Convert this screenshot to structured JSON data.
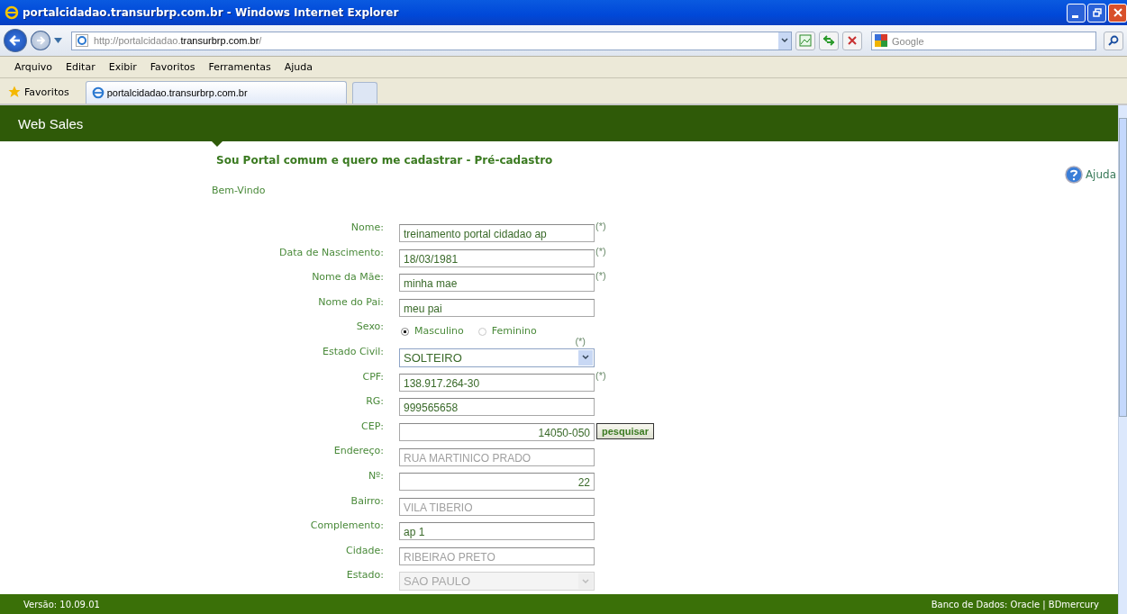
{
  "window": {
    "title": "portalcidadao.transurbrp.com.br - Windows Internet Explorer"
  },
  "address_bar": {
    "url_prefix": "http://portalcidadao.",
    "url_domain": "transurbrp.com.br",
    "url_suffix": "/"
  },
  "search": {
    "placeholder": "Google"
  },
  "menu": [
    "Arquivo",
    "Editar",
    "Exibir",
    "Favoritos",
    "Ferramentas",
    "Ajuda"
  ],
  "favorites_bar": {
    "label": "Favoritos",
    "tabs": [
      {
        "title": "portalcidadao.transurbrp.com.br",
        "selected": true
      }
    ]
  },
  "page": {
    "app_title": "Web Sales",
    "heading": "Sou Portal comum e quero me cadastrar - Pré-cadastro",
    "welcome": "Bem-Vindo",
    "help": "Ajuda",
    "fields": [
      {
        "kind": "text",
        "label": "Nome:",
        "value": "treinamento portal cidadao ap",
        "required": "(*)",
        "disabled": false
      },
      {
        "kind": "text",
        "label": "Data de Nascimento:",
        "value": "18/03/1981",
        "required": "(*)",
        "disabled": false
      },
      {
        "kind": "text",
        "label": "Nome da Mãe:",
        "value": "minha mae",
        "required": "(*)",
        "disabled": false
      },
      {
        "kind": "text",
        "label": "Nome do Pai:",
        "value": "meu pai",
        "disabled": false
      },
      {
        "kind": "radio",
        "label": "Sexo:",
        "options": [
          {
            "label": "Masculino",
            "selected": true
          },
          {
            "label": "Feminino",
            "selected": false
          }
        ]
      },
      {
        "kind": "select",
        "label": "Estado Civil:",
        "value": "SOLTEIRO",
        "required": "(*)",
        "disabled": false
      },
      {
        "kind": "text",
        "label": "CPF:",
        "value": "138.917.264-30",
        "required": "(*)",
        "disabled": false
      },
      {
        "kind": "text",
        "label": "RG:",
        "value": "999565658",
        "disabled": false
      },
      {
        "kind": "number",
        "label": "CEP:",
        "value": "14050-050",
        "disabled": false,
        "button": "pesquisar"
      },
      {
        "kind": "text",
        "label": "Endereço:",
        "value": "RUA MARTINICO PRADO",
        "disabled": true
      },
      {
        "kind": "number",
        "label": "Nº:",
        "value": "22",
        "disabled": false
      },
      {
        "kind": "text",
        "label": "Bairro:",
        "value": "VILA TIBERIO",
        "disabled": true
      },
      {
        "kind": "text",
        "label": "Complemento:",
        "value": "ap 1",
        "disabled": false
      },
      {
        "kind": "text",
        "label": "Cidade:",
        "value": "RIBEIRAO PRETO",
        "disabled": true
      },
      {
        "kind": "select",
        "label": "Estado:",
        "value": "SAO PAULO",
        "disabled": true
      }
    ],
    "footer": {
      "version": "Versão: 10.09.01",
      "database": "Banco de Dados: Oracle | BDmercury"
    }
  }
}
